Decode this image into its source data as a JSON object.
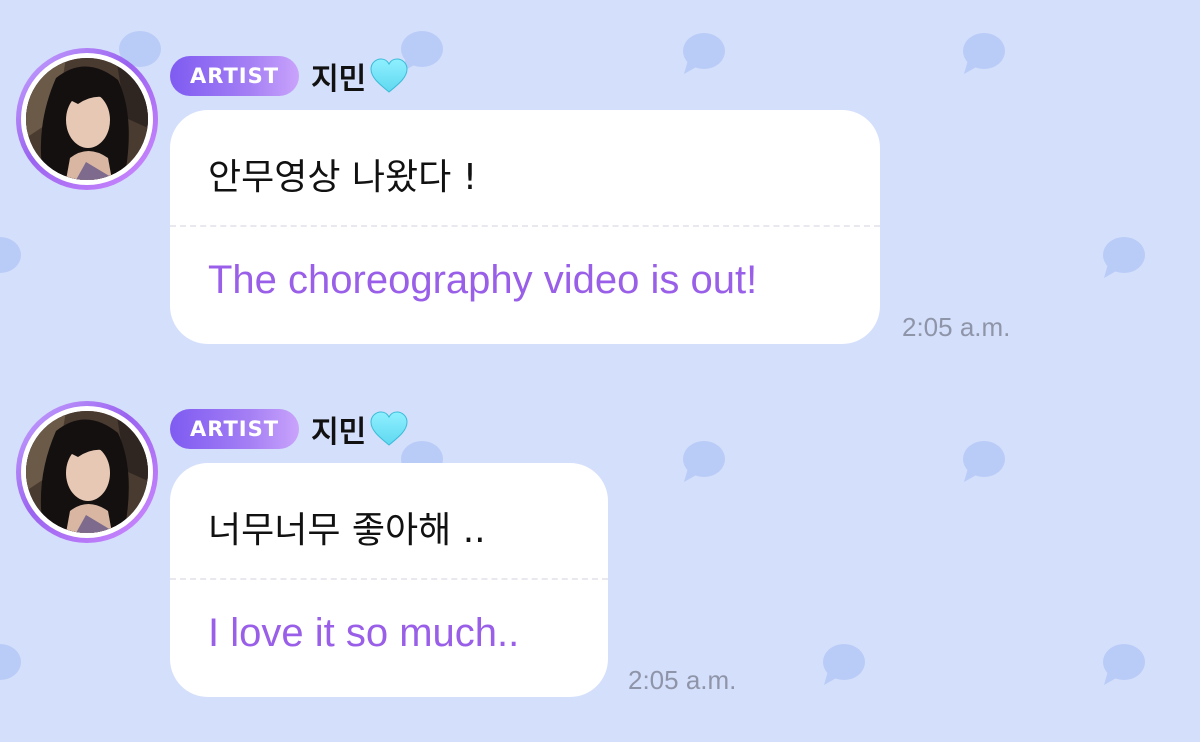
{
  "theme": {
    "background": "#d4dffb",
    "bg_icon_color": "#b9cbf7",
    "badge_gradient": [
      "#7f5bf2",
      "#c9a3fb"
    ],
    "translation_color": "#9a5fe8",
    "timestamp_color": "#8f95a8",
    "heart_color": "#5fd8f0"
  },
  "background_icons": "speech-bubble-icon",
  "messages": [
    {
      "badge": "ARTIST",
      "name": "지민",
      "name_icon": "light-blue-heart-icon",
      "avatar": "artist-avatar",
      "text": "안무영상 나왔다 !",
      "translation": "The choreography video is out!",
      "time": "2:05 a.m."
    },
    {
      "badge": "ARTIST",
      "name": "지민",
      "name_icon": "light-blue-heart-icon",
      "avatar": "artist-avatar",
      "text": "너무너무 좋아해 ..",
      "translation": "I love it so much..",
      "time": "2:05 a.m."
    }
  ]
}
